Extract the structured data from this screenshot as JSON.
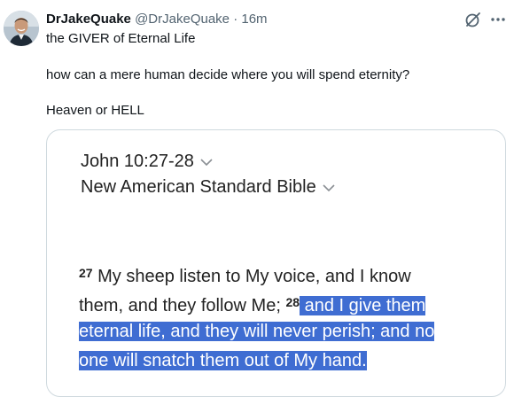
{
  "tweet": {
    "author_name": "DrJakeQuake",
    "handle": "@DrJakeQuake",
    "separator": "·",
    "timestamp": "16m",
    "lines": {
      "title": "the GIVER of Eternal Life",
      "question": "how can a mere human decide where you will spend eternity?",
      "choice": "Heaven or HELL"
    },
    "icons": {
      "grok": "grok-icon",
      "more": "more-horizontal-icon",
      "avatar": "avatar-photo"
    }
  },
  "image": {
    "passage": "John 10:27-28",
    "version": "New American Standard Bible",
    "verse_lines": {
      "l1_num": "27",
      "l1_text": " My sheep listen to My voice, and I know",
      "l2_text": "them, and they follow Me; ",
      "l2_num": "28",
      "l2_highlight": " and I give them",
      "l3_highlight": "eternal life, and they will never perish; and no",
      "l4_highlight": "one will snatch them out of My hand."
    },
    "highlight_color": "#3f6dd2"
  },
  "colors": {
    "text": "#0f1419",
    "muted": "#536471",
    "border": "#cfd9de"
  }
}
